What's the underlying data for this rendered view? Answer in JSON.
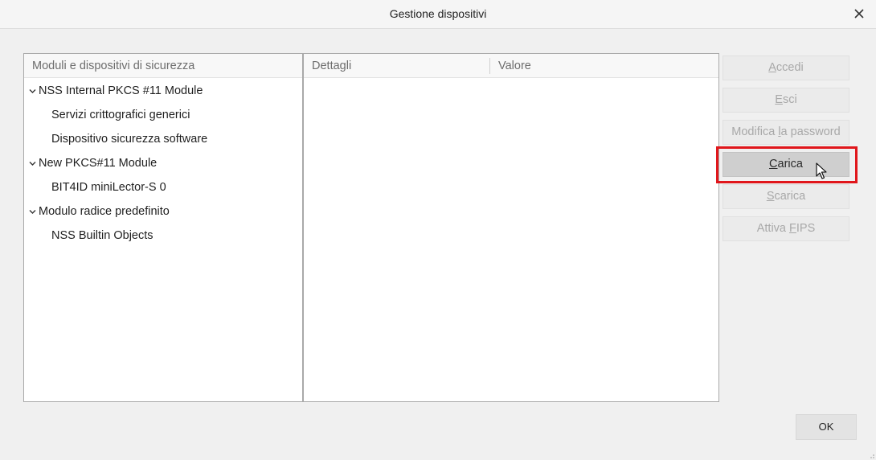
{
  "window": {
    "title": "Gestione dispositivi",
    "close_icon": "close-icon"
  },
  "modules_panel": {
    "header": "Moduli e dispositivi di sicurezza",
    "items": [
      {
        "type": "module",
        "label": "NSS Internal PKCS #11 Module",
        "expanded": true
      },
      {
        "type": "device",
        "label": "Servizi crittografici generici"
      },
      {
        "type": "device",
        "label": "Dispositivo sicurezza software"
      },
      {
        "type": "module",
        "label": "New PKCS#11 Module",
        "expanded": true
      },
      {
        "type": "device",
        "label": "BIT4ID miniLector-S 0"
      },
      {
        "type": "module",
        "label": "Modulo radice predefinito",
        "expanded": true
      },
      {
        "type": "device",
        "label": "NSS Builtin Objects"
      }
    ]
  },
  "details_panel": {
    "col_details": "Dettagli",
    "col_value": "Valore"
  },
  "buttons": {
    "login": {
      "pre": "",
      "accel": "A",
      "post": "ccedi",
      "enabled": false
    },
    "logout": {
      "pre": "",
      "accel": "E",
      "post": "sci",
      "enabled": false
    },
    "change_password": {
      "pre": "Modifica ",
      "accel": "l",
      "post": "a password",
      "enabled": false
    },
    "load": {
      "pre": "",
      "accel": "C",
      "post": "arica",
      "enabled": true
    },
    "unload": {
      "pre": "",
      "accel": "S",
      "post": "carica",
      "enabled": false
    },
    "fips": {
      "pre": "Attiva ",
      "accel": "F",
      "post": "IPS",
      "enabled": false
    },
    "ok": "OK"
  },
  "colors": {
    "highlight": "#e0161b",
    "active_button": "#cfcfcf",
    "disabled_text": "#a8a8a8"
  }
}
